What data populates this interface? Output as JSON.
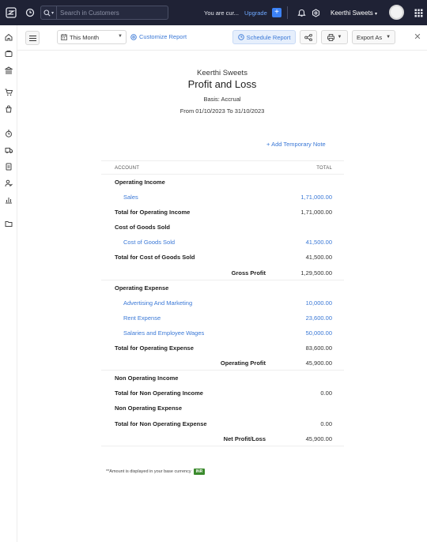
{
  "topbar": {
    "search_placeholder": "Search in Customers",
    "trial_text": "You are cur...",
    "upgrade_label": "Upgrade",
    "plus_label": "+",
    "org_name": "Keerthi Sweets",
    "org_caret": "▾"
  },
  "toolbar": {
    "period_label": "This Month",
    "customize_label": "Customize Report",
    "schedule_label": "Schedule Report",
    "export_label": "Export As",
    "close_label": "✕"
  },
  "report": {
    "company": "Keerthi Sweets",
    "title": "Profit and Loss",
    "basis": "Basis: Accrual",
    "range": "From 01/10/2023 To 31/10/2023",
    "add_note": "Add Temporary Note",
    "col_account": "ACCOUNT",
    "col_total": "TOTAL",
    "rows": [
      {
        "type": "section",
        "label": "Operating Income",
        "amount": ""
      },
      {
        "type": "item",
        "label": "Sales",
        "amount": "1,71,000.00"
      },
      {
        "type": "total",
        "label": "Total for Operating Income",
        "amount": "1,71,000.00"
      },
      {
        "type": "section",
        "label": "Cost of Goods Sold",
        "amount": ""
      },
      {
        "type": "item",
        "label": "Cost of Goods Sold",
        "amount": "41,500.00"
      },
      {
        "type": "total",
        "label": "Total for Cost of Goods Sold",
        "amount": "41,500.00"
      },
      {
        "type": "summary",
        "label": "Gross Profit",
        "amount": "1,29,500.00"
      },
      {
        "type": "section",
        "label": "Operating Expense",
        "amount": ""
      },
      {
        "type": "item",
        "label": "Advertising And Marketing",
        "amount": "10,000.00"
      },
      {
        "type": "item",
        "label": "Rent Expense",
        "amount": "23,600.00"
      },
      {
        "type": "item",
        "label": "Salaries and Employee Wages",
        "amount": "50,000.00"
      },
      {
        "type": "total",
        "label": "Total for Operating Expense",
        "amount": "83,600.00"
      },
      {
        "type": "summary",
        "label": "Operating Profit",
        "amount": "45,900.00"
      },
      {
        "type": "section",
        "label": "Non Operating Income",
        "amount": ""
      },
      {
        "type": "total",
        "label": "Total for Non Operating Income",
        "amount": "0.00"
      },
      {
        "type": "section",
        "label": "Non Operating Expense",
        "amount": ""
      },
      {
        "type": "total",
        "label": "Total for Non Operating Expense",
        "amount": "0.00"
      },
      {
        "type": "summary",
        "label": "Net Profit/Loss",
        "amount": "45,900.00"
      }
    ],
    "footnote": "**Amount is displayed in your base currency",
    "currency_badge": "INR"
  },
  "colors": {
    "topbar_bg": "#1f2235",
    "link_blue": "#3a78d6",
    "badge_green": "#3a8a2c"
  },
  "icons": {
    "sidebar": [
      "home-icon",
      "items-icon",
      "banking-icon",
      "sales-icon",
      "purchases-icon",
      "time-tracking-icon",
      "accountant-icon",
      "documents-icon",
      "users-icon",
      "reports-icon",
      "folder-icon"
    ]
  }
}
